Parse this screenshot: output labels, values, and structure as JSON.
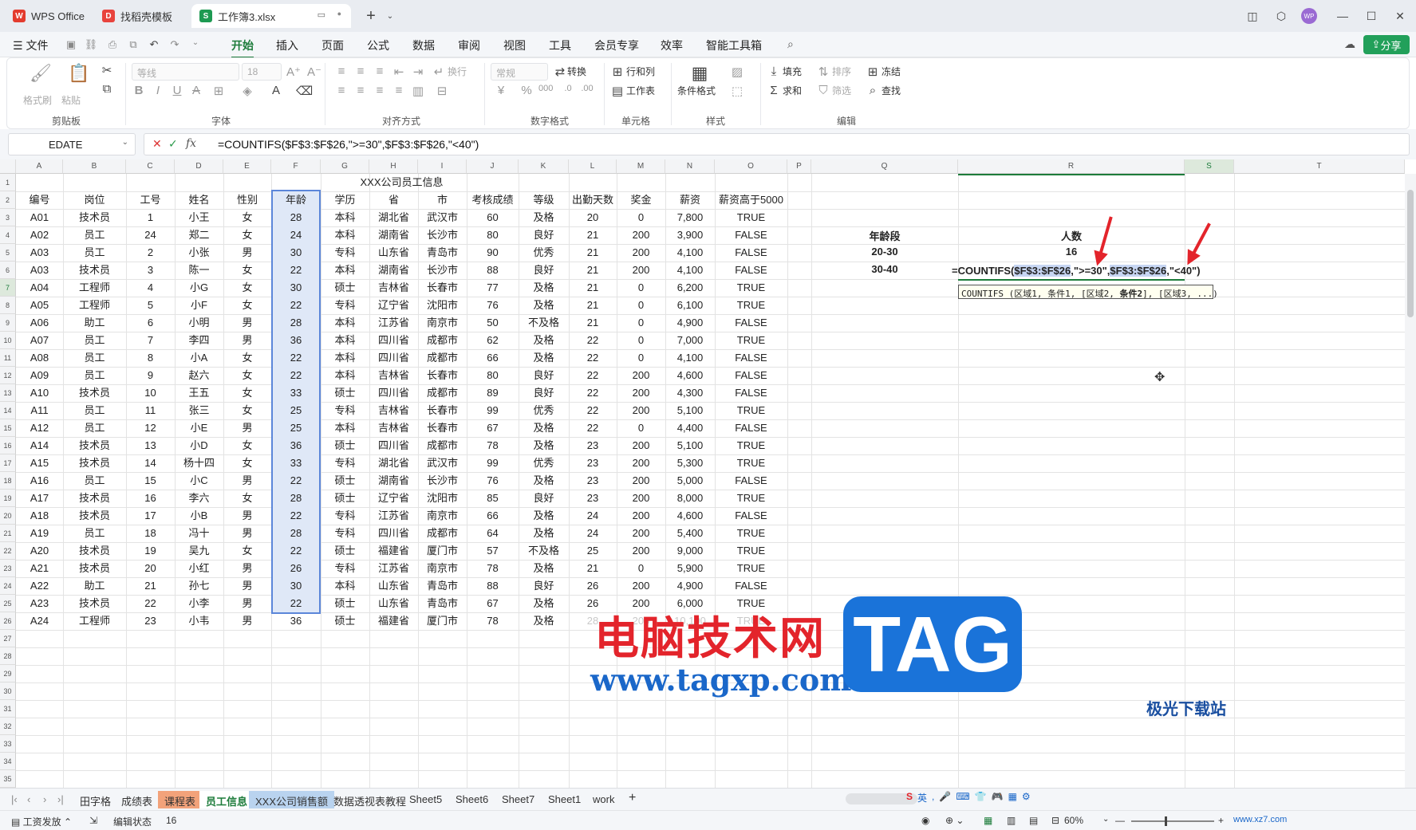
{
  "window_tabs": [
    {
      "label": "WPS Office",
      "icon": "wps-logo-icon",
      "color": "#e33b2e"
    },
    {
      "label": "找稻壳模板",
      "icon": "docer-icon",
      "color": "#e8433d"
    },
    {
      "label": "工作簿3.xlsx",
      "icon": "spreadsheet-s-icon",
      "color": "#1d9a52"
    }
  ],
  "avatar_text": "WP",
  "menu": {
    "file": "文件",
    "items": [
      "开始",
      "插入",
      "页面",
      "公式",
      "数据",
      "审阅",
      "视图",
      "工具",
      "会员专享",
      "效率",
      "智能工具箱"
    ],
    "active": "开始",
    "share": "分享"
  },
  "ribbon": {
    "clipboard": {
      "label": "剪贴板",
      "format_painter": "格式刷",
      "paste": "粘贴"
    },
    "font": {
      "label": "字体",
      "font_name": "等线",
      "font_size": "18"
    },
    "alignment": {
      "label": "对齐方式",
      "wrap": "换行"
    },
    "number": {
      "label": "数字格式",
      "format": "常规",
      "convert": "转换"
    },
    "cells": {
      "label": "单元格",
      "rows_cols": "行和列",
      "worksheet": "工作表"
    },
    "styles": {
      "label": "样式",
      "conditional": "条件格式"
    },
    "edit": {
      "label": "编辑",
      "fill": "填充",
      "sort": "排序",
      "freeze": "冻结",
      "sum": "求和",
      "filter": "筛选",
      "find": "查找"
    }
  },
  "formula_bar": {
    "name_box": "EDATE",
    "fx": "fx",
    "formula": "=COUNTIFS($F$3:$F$26,\">=30\",$F$3:$F$26,\"<40\")"
  },
  "columns": [
    "A",
    "B",
    "C",
    "D",
    "E",
    "F",
    "G",
    "H",
    "I",
    "J",
    "K",
    "L",
    "M",
    "N",
    "O",
    "P",
    "Q",
    "R",
    "S",
    "T"
  ],
  "title": "XXX公司员工信息",
  "headers": [
    "编号",
    "岗位",
    "工号",
    "姓名",
    "性别",
    "年龄",
    "学历",
    "省",
    "市",
    "考核成绩",
    "等级",
    "出勤天数",
    "奖金",
    "薪资",
    "薪资高于5000"
  ],
  "rows": [
    [
      "A01",
      "技术员",
      "1",
      "小王",
      "女",
      "28",
      "本科",
      "湖北省",
      "武汉市",
      "60",
      "及格",
      "20",
      "0",
      "7,800",
      "TRUE"
    ],
    [
      "A02",
      "员工",
      "24",
      "郑二",
      "女",
      "24",
      "本科",
      "湖南省",
      "长沙市",
      "80",
      "良好",
      "21",
      "200",
      "3,900",
      "FALSE"
    ],
    [
      "A03",
      "员工",
      "2",
      "小张",
      "男",
      "30",
      "专科",
      "山东省",
      "青岛市",
      "90",
      "优秀",
      "21",
      "200",
      "4,100",
      "FALSE"
    ],
    [
      "A03",
      "技术员",
      "3",
      "陈一",
      "女",
      "22",
      "本科",
      "湖南省",
      "长沙市",
      "88",
      "良好",
      "21",
      "200",
      "4,100",
      "FALSE"
    ],
    [
      "A04",
      "工程师",
      "4",
      "小G",
      "女",
      "30",
      "硕士",
      "吉林省",
      "长春市",
      "77",
      "及格",
      "21",
      "0",
      "6,200",
      "TRUE"
    ],
    [
      "A05",
      "工程师",
      "5",
      "小F",
      "女",
      "22",
      "专科",
      "辽宁省",
      "沈阳市",
      "76",
      "及格",
      "21",
      "0",
      "6,100",
      "TRUE"
    ],
    [
      "A06",
      "助工",
      "6",
      "小明",
      "男",
      "28",
      "本科",
      "江苏省",
      "南京市",
      "50",
      "不及格",
      "21",
      "0",
      "4,900",
      "FALSE"
    ],
    [
      "A07",
      "员工",
      "7",
      "李四",
      "男",
      "36",
      "本科",
      "四川省",
      "成都市",
      "62",
      "及格",
      "22",
      "0",
      "7,000",
      "TRUE"
    ],
    [
      "A08",
      "员工",
      "8",
      "小A",
      "女",
      "22",
      "本科",
      "四川省",
      "成都市",
      "66",
      "及格",
      "22",
      "0",
      "4,100",
      "FALSE"
    ],
    [
      "A09",
      "员工",
      "9",
      "赵六",
      "女",
      "22",
      "本科",
      "吉林省",
      "长春市",
      "80",
      "良好",
      "22",
      "200",
      "4,600",
      "FALSE"
    ],
    [
      "A10",
      "技术员",
      "10",
      "王五",
      "女",
      "33",
      "硕士",
      "四川省",
      "成都市",
      "89",
      "良好",
      "22",
      "200",
      "4,300",
      "FALSE"
    ],
    [
      "A11",
      "员工",
      "11",
      "张三",
      "女",
      "25",
      "专科",
      "吉林省",
      "长春市",
      "99",
      "优秀",
      "22",
      "200",
      "5,100",
      "TRUE"
    ],
    [
      "A12",
      "员工",
      "12",
      "小E",
      "男",
      "25",
      "本科",
      "吉林省",
      "长春市",
      "67",
      "及格",
      "22",
      "0",
      "4,400",
      "FALSE"
    ],
    [
      "A14",
      "技术员",
      "13",
      "小D",
      "女",
      "36",
      "硕士",
      "四川省",
      "成都市",
      "78",
      "及格",
      "23",
      "200",
      "5,100",
      "TRUE"
    ],
    [
      "A15",
      "技术员",
      "14",
      "杨十四",
      "女",
      "33",
      "专科",
      "湖北省",
      "武汉市",
      "99",
      "优秀",
      "23",
      "200",
      "5,300",
      "TRUE"
    ],
    [
      "A16",
      "员工",
      "15",
      "小C",
      "男",
      "22",
      "硕士",
      "湖南省",
      "长沙市",
      "76",
      "及格",
      "23",
      "200",
      "5,000",
      "FALSE"
    ],
    [
      "A17",
      "技术员",
      "16",
      "李六",
      "女",
      "28",
      "硕士",
      "辽宁省",
      "沈阳市",
      "85",
      "良好",
      "23",
      "200",
      "8,000",
      "TRUE"
    ],
    [
      "A18",
      "技术员",
      "17",
      "小B",
      "男",
      "22",
      "专科",
      "江苏省",
      "南京市",
      "66",
      "及格",
      "24",
      "200",
      "4,600",
      "FALSE"
    ],
    [
      "A19",
      "员工",
      "18",
      "冯十",
      "男",
      "28",
      "专科",
      "四川省",
      "成都市",
      "64",
      "及格",
      "24",
      "200",
      "5,400",
      "TRUE"
    ],
    [
      "A20",
      "技术员",
      "19",
      "吴九",
      "女",
      "22",
      "硕士",
      "福建省",
      "厦门市",
      "57",
      "不及格",
      "25",
      "200",
      "9,000",
      "TRUE"
    ],
    [
      "A21",
      "技术员",
      "20",
      "小红",
      "男",
      "26",
      "专科",
      "江苏省",
      "南京市",
      "78",
      "及格",
      "21",
      "0",
      "5,900",
      "TRUE"
    ],
    [
      "A22",
      "助工",
      "21",
      "孙七",
      "男",
      "30",
      "本科",
      "山东省",
      "青岛市",
      "88",
      "良好",
      "26",
      "200",
      "4,900",
      "FALSE"
    ],
    [
      "A23",
      "技术员",
      "22",
      "小李",
      "男",
      "22",
      "硕士",
      "山东省",
      "青岛市",
      "67",
      "及格",
      "26",
      "200",
      "6,000",
      "TRUE"
    ],
    [
      "A24",
      "工程师",
      "23",
      "小韦",
      "男",
      "36",
      "硕士",
      "福建省",
      "厦门市",
      "78",
      "及格",
      "28",
      "200",
      "10,100",
      "TRUE"
    ]
  ],
  "side_table": {
    "header_left": "年龄段",
    "header_right": "人数",
    "r1_left": "20-30",
    "r1_right": "16",
    "r2_left": "30-40",
    "editing_formula": {
      "prefix": "=COUNTIFS(",
      "range1": "$F$3:$F$26",
      "mid": ",\">=30\",",
      "range2": "$F$3:$F$26",
      "suffix": ",\"<40\")"
    },
    "tooltip": {
      "pre": "COUNTIFS (区域1, 条件1, [区域2, ",
      "bold": "条件2",
      "post": "], [区域3, ...)"
    }
  },
  "sheet_tabs": [
    {
      "label": "田字格",
      "color": ""
    },
    {
      "label": "成绩表",
      "color": ""
    },
    {
      "label": "课程表",
      "color": "#f2a27a"
    },
    {
      "label": "员工信息",
      "color": "",
      "active": true
    },
    {
      "label": "XXX公司销售额",
      "color": "#b9d3ef"
    },
    {
      "label": "数据透视表教程",
      "color": ""
    },
    {
      "label": "Sheet5",
      "color": ""
    },
    {
      "label": "Sheet6",
      "color": ""
    },
    {
      "label": "Sheet7",
      "color": ""
    },
    {
      "label": "Sheet1",
      "color": ""
    },
    {
      "label": "work",
      "color": ""
    }
  ],
  "status": {
    "mode": "工资发放",
    "edit_state": "编辑状态",
    "count": "16",
    "zoom": "60%"
  },
  "ime": {
    "lang": "英"
  },
  "watermark": {
    "text1": "电脑技术网",
    "text2": "www.tagxp.com",
    "badge": "TAG",
    "site": "极光下载站",
    "site_url": "www.xz7.com"
  }
}
